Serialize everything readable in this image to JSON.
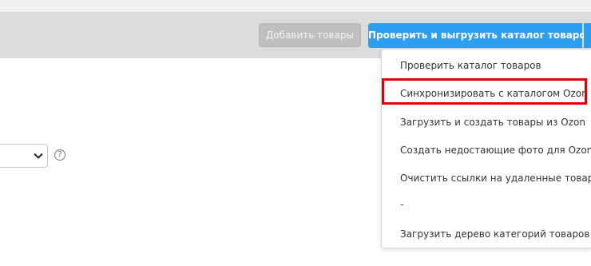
{
  "toolbar": {
    "add_products_label": "Добавить товары",
    "check_export_label": "Проверить и выгрузить каталог товаров"
  },
  "dropdown": {
    "items": [
      "Проверить каталог товаров",
      "Синхронизировать с каталогом Ozon",
      "Загрузить и создать товары из Ozon",
      "Создать недостающие фото для Ozon",
      "Очистить ссылки на удаленные товары",
      "-",
      "Загрузить дерево категорий товаров"
    ],
    "highlighted_index": 1
  },
  "form": {
    "help_glyph": "?"
  },
  "colors": {
    "accent": "#2d9ff0",
    "highlight_border": "#e00000",
    "toolbar_bg": "#dcdcdc",
    "disabled_button": "#bfbfbf"
  }
}
